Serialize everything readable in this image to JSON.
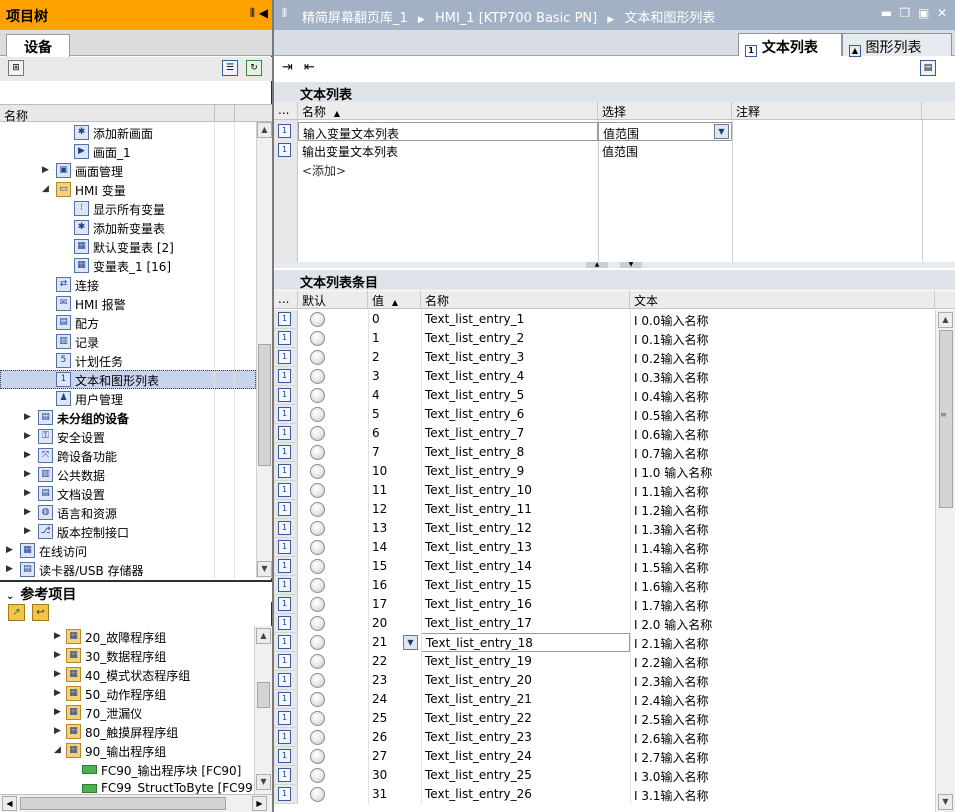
{
  "project_tree": {
    "title": "项目树",
    "devices_tab": "设备",
    "name_header": "名称",
    "items": [
      {
        "label": "添加新画面",
        "icon": "add-screen-icon",
        "bold": false
      },
      {
        "label": "画面_1",
        "icon": "screen-icon",
        "bold": false
      },
      {
        "label": "画面管理",
        "icon": "screen-management-icon",
        "bold": false
      },
      {
        "label": "HMI 变量",
        "icon": "folder-icon",
        "bold": false
      },
      {
        "label": "显示所有变量",
        "icon": "tags-icon",
        "bold": false
      },
      {
        "label": "添加新变量表",
        "icon": "add-tag-table-icon",
        "bold": false
      },
      {
        "label": "默认变量表 [2]",
        "icon": "tag-table-icon",
        "bold": false
      },
      {
        "label": "变量表_1 [16]",
        "icon": "tag-table-icon",
        "bold": false
      },
      {
        "label": "连接",
        "icon": "connection-icon",
        "bold": false
      },
      {
        "label": "HMI 报警",
        "icon": "alarm-icon",
        "bold": false
      },
      {
        "label": "配方",
        "icon": "recipe-icon",
        "bold": false
      },
      {
        "label": "记录",
        "icon": "log-icon",
        "bold": false
      },
      {
        "label": "计划任务",
        "icon": "scheduler-icon",
        "bold": false
      },
      {
        "label": "文本和图形列表",
        "icon": "text-graphic-list-icon",
        "bold": false
      },
      {
        "label": "用户管理",
        "icon": "user-icon",
        "bold": false
      },
      {
        "label": "未分组的设备",
        "icon": "ungrouped-devices-icon",
        "bold": true
      },
      {
        "label": "安全设置",
        "icon": "security-icon",
        "bold": false
      },
      {
        "label": "跨设备功能",
        "icon": "cross-device-icon",
        "bold": false
      },
      {
        "label": "公共数据",
        "icon": "common-data-icon",
        "bold": false
      },
      {
        "label": "文档设置",
        "icon": "document-settings-icon",
        "bold": false
      },
      {
        "label": "语言和资源",
        "icon": "language-icon",
        "bold": false
      },
      {
        "label": "版本控制接口",
        "icon": "version-control-icon",
        "bold": false
      },
      {
        "label": "在线访问",
        "icon": "online-access-icon",
        "bold": false
      },
      {
        "label": "读卡器/USB 存储器",
        "icon": "card-reader-icon",
        "bold": false
      }
    ]
  },
  "reference_projects": {
    "title": "参考项目",
    "items": [
      {
        "label": "20_故障程序组"
      },
      {
        "label": "30_数据程序组"
      },
      {
        "label": "40_模式状态程序组"
      },
      {
        "label": "50_动作程序组"
      },
      {
        "label": "70_泄漏仪"
      },
      {
        "label": "80_触摸屏程序组"
      },
      {
        "label": "90_输出程序组"
      },
      {
        "label": "FC90_输出程序块 [FC90]"
      },
      {
        "label": "FC99_StructToByte [FC99]"
      }
    ]
  },
  "editor": {
    "breadcrumb": [
      "精简屏幕翻页库_1",
      "HMI_1 [KTP700 Basic PN]",
      "文本和图形列表"
    ],
    "tabs": [
      "文本列表",
      "图形列表"
    ],
    "text_lists": {
      "title": "文本列表",
      "headers": [
        "...",
        "名称",
        "选择",
        "注释"
      ],
      "rows": [
        {
          "name": "输入变量文本列表",
          "selection": "值范围"
        },
        {
          "name": "输出变量文本列表",
          "selection": "值范围"
        }
      ],
      "add_label": "<添加>"
    },
    "entries": {
      "title": "文本列表条目",
      "headers": [
        "...",
        "默认",
        "值",
        "名称",
        "文本"
      ],
      "rows": [
        {
          "value": "0",
          "name": "Text_list_entry_1",
          "text": "I 0.0输入名称"
        },
        {
          "value": "1",
          "name": "Text_list_entry_2",
          "text": "I 0.1输入名称"
        },
        {
          "value": "2",
          "name": "Text_list_entry_3",
          "text": "I 0.2输入名称"
        },
        {
          "value": "3",
          "name": "Text_list_entry_4",
          "text": "I 0.3输入名称"
        },
        {
          "value": "4",
          "name": "Text_list_entry_5",
          "text": "I 0.4输入名称"
        },
        {
          "value": "5",
          "name": "Text_list_entry_6",
          "text": "I 0.5输入名称"
        },
        {
          "value": "6",
          "name": "Text_list_entry_7",
          "text": "I 0.6输入名称"
        },
        {
          "value": "7",
          "name": "Text_list_entry_8",
          "text": "I 0.7输入名称"
        },
        {
          "value": "10",
          "name": "Text_list_entry_9",
          "text": "I 1.0 输入名称"
        },
        {
          "value": "11",
          "name": "Text_list_entry_10",
          "text": "I 1.1输入名称"
        },
        {
          "value": "12",
          "name": "Text_list_entry_11",
          "text": "I 1.2输入名称"
        },
        {
          "value": "13",
          "name": "Text_list_entry_12",
          "text": "I 1.3输入名称"
        },
        {
          "value": "14",
          "name": "Text_list_entry_13",
          "text": "I 1.4输入名称"
        },
        {
          "value": "15",
          "name": "Text_list_entry_14",
          "text": "I 1.5输入名称"
        },
        {
          "value": "16",
          "name": "Text_list_entry_15",
          "text": "I 1.6输入名称"
        },
        {
          "value": "17",
          "name": "Text_list_entry_16",
          "text": "I 1.7输入名称"
        },
        {
          "value": "20",
          "name": "Text_list_entry_17",
          "text": "I 2.0 输入名称"
        },
        {
          "value": "21",
          "name": "Text_list_entry_18",
          "text": "I 2.1输入名称"
        },
        {
          "value": "22",
          "name": "Text_list_entry_19",
          "text": "I 2.2输入名称"
        },
        {
          "value": "23",
          "name": "Text_list_entry_20",
          "text": "I 2.3输入名称"
        },
        {
          "value": "24",
          "name": "Text_list_entry_21",
          "text": "I 2.4输入名称"
        },
        {
          "value": "25",
          "name": "Text_list_entry_22",
          "text": "I 2.5输入名称"
        },
        {
          "value": "26",
          "name": "Text_list_entry_23",
          "text": "I 2.6输入名称"
        },
        {
          "value": "27",
          "name": "Text_list_entry_24",
          "text": "I 2.7输入名称"
        },
        {
          "value": "30",
          "name": "Text_list_entry_25",
          "text": "I 3.0输入名称"
        },
        {
          "value": "31",
          "name": "Text_list_entry_26",
          "text": "I 3.1输入名称"
        }
      ]
    }
  },
  "colors": {
    "accent_orange": "#ffa200",
    "editor_title": "#a3b1c4",
    "selection": "#c7d4ec"
  }
}
